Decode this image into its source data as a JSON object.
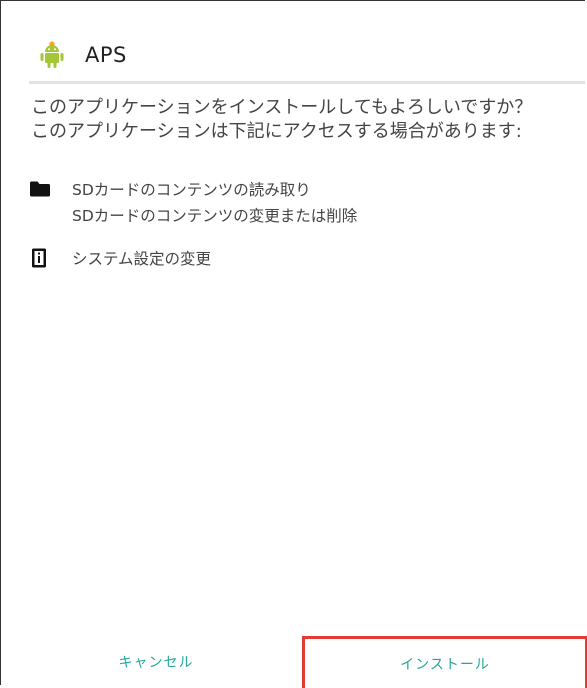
{
  "dialog": {
    "app_name": "APS",
    "app_icon": "android-robot-icon",
    "question_line1": "このアプリケーションをインストールしてもよろしいですか？",
    "question_line2": "このアプリケーションは下記にアクセスする場合があります:"
  },
  "permissions": {
    "storage": {
      "icon": "folder-icon",
      "line1": "SDカードのコンテンツの読み取り",
      "line2": "SDカードのコンテンツの変更または削除"
    },
    "settings": {
      "icon": "settings-device-icon",
      "line1": "システム設定の変更"
    }
  },
  "buttons": {
    "cancel": "キャンセル",
    "install": "インストール"
  },
  "colors": {
    "accent": "#26a69a",
    "highlight": "#e53935",
    "android_green": "#a4c639"
  }
}
